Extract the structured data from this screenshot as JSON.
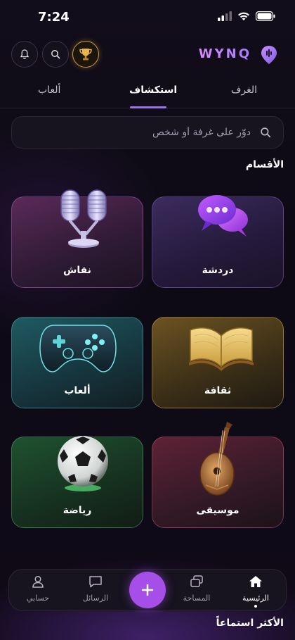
{
  "status_bar": {
    "time": "7:24"
  },
  "header": {
    "logo_text": "WYNQ"
  },
  "tabs": [
    {
      "label": "الغرف"
    },
    {
      "label": "استكشاف"
    },
    {
      "label": "ألعاب"
    }
  ],
  "search": {
    "placeholder": "دوّر على غرفة أو شخص"
  },
  "sections": {
    "categories_title": "الأقسام",
    "most_listened_title": "الأكثر استماعاً"
  },
  "categories": [
    {
      "label": "دردشة",
      "icon": "chat-bubbles-icon",
      "color": "#7a54c0"
    },
    {
      "label": "نقاش",
      "icon": "microphone-icon",
      "color": "#8a3a8e"
    },
    {
      "label": "ثقافة",
      "icon": "open-book-icon",
      "color": "#c9a23a"
    },
    {
      "label": "ألعاب",
      "icon": "gamepad-icon",
      "color": "#2f8f8f"
    },
    {
      "label": "موسيقى",
      "icon": "oud-icon",
      "color": "#c0486a"
    },
    {
      "label": "رياضة",
      "icon": "soccer-ball-icon",
      "color": "#3a9a4a"
    }
  ],
  "bottom_nav": [
    {
      "label": "الرئيسية",
      "icon": "home-icon"
    },
    {
      "label": "المساحة",
      "icon": "spaces-icon"
    },
    {
      "label": "الرسائل",
      "icon": "chat-icon"
    },
    {
      "label": "حسابي",
      "icon": "user-icon"
    }
  ],
  "colors": {
    "accent": "#a64ee8",
    "tab_underline": "#9b74e8",
    "background": "#0d0a14"
  }
}
